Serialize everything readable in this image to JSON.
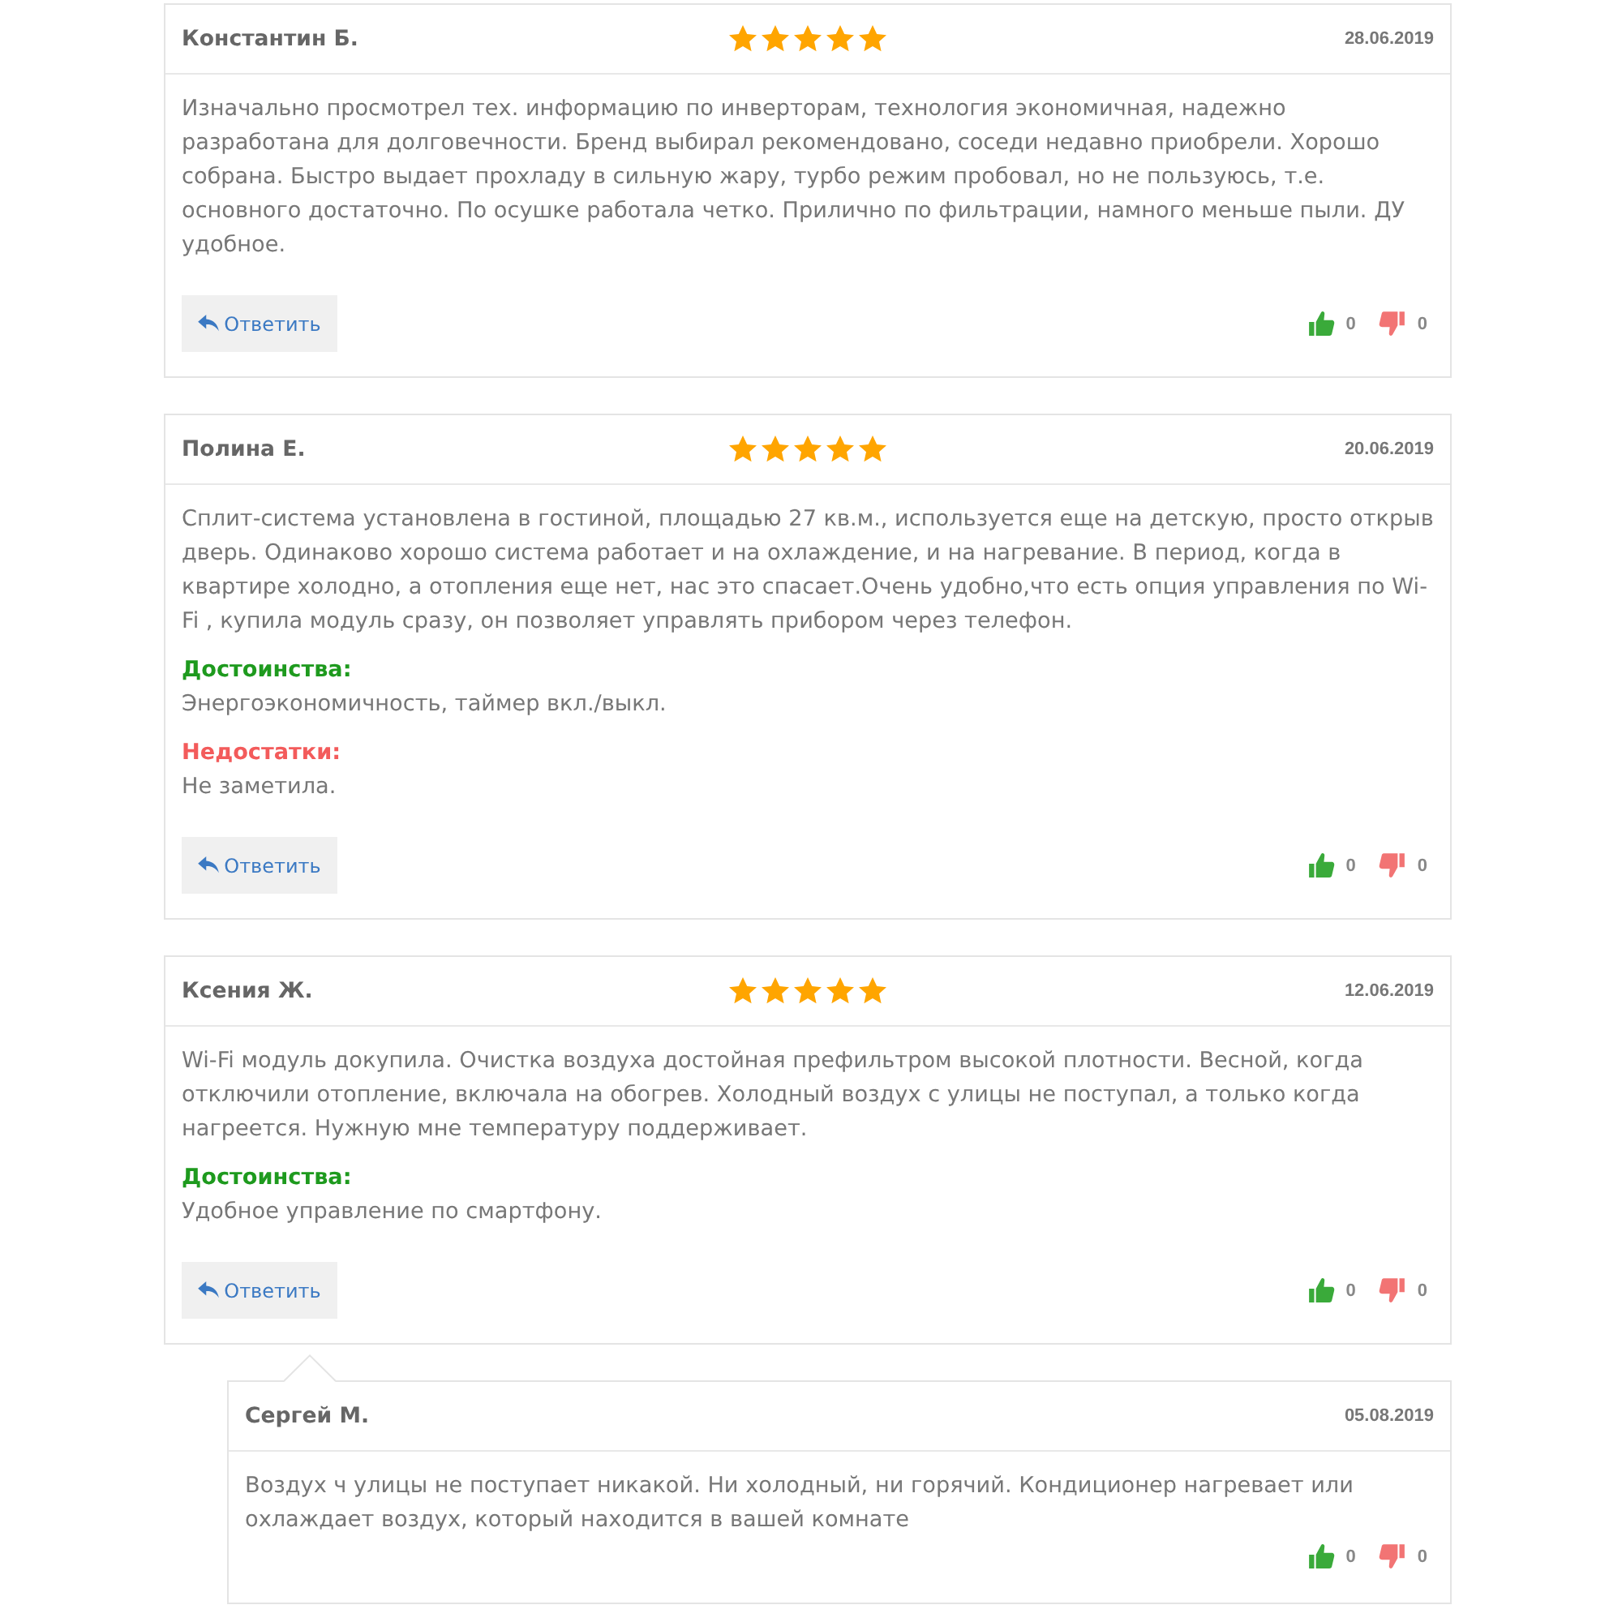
{
  "reviews": [
    {
      "author": "Константин Б.",
      "stars": 5,
      "date": "28.06.2019",
      "text": "Изначально просмотрел тех. информацию по инверторам, технология экономичная, надежно разработана для долговечности. Бренд выбирал рекомендовано, соседи недавно приобрели. Хорошо собрана. Быстро выдает прохладу в сильную жару, турбо режим пробовал, но не пользуюсь, т.е. основного достаточно. По осушке работала четко. Прилично по фильтрации, намного меньше пыли. ДУ удобное.",
      "reply_button": "Ответить",
      "likes": "0",
      "dislikes": "0"
    },
    {
      "author": "Полина Е.",
      "stars": 5,
      "date": "20.06.2019",
      "text": "Сплит-система установлена в гостиной, площадью 27 кв.м., используется еще на детскую, просто открыв дверь. Одинаково хорошо система работает и на охлаждение, и на нагревание. В период, когда в квартире холодно, а отопления еще нет, нас это спасает.Очень удобно,что есть опция управления по Wi-Fi , купила модуль сразу, он позволяет управлять прибором через телефон.",
      "sections": [
        {
          "kind": "pros",
          "label": "Достоинства:",
          "text": "Энергоэкономичность, таймер вкл./выкл."
        },
        {
          "kind": "cons",
          "label": "Недостатки:",
          "text": "Не заметила."
        }
      ],
      "reply_button": "Ответить",
      "likes": "0",
      "dislikes": "0"
    },
    {
      "author": "Ксения Ж.",
      "stars": 5,
      "date": "12.06.2019",
      "text": "Wi-Fi модуль докупила. Очистка воздуха достойная префильтром высокой плотности. Весной, когда отключили отопление, включала на обогрев. Холодный воздух с улицы не поступал, а только когда нагреется. Нужную мне температуру поддерживает.",
      "sections": [
        {
          "kind": "pros",
          "label": "Достоинства:",
          "text": "Удобное управление по смартфону."
        }
      ],
      "reply_button": "Ответить",
      "likes": "0",
      "dislikes": "0",
      "replies": [
        {
          "author": "Сергей М.",
          "date": "05.08.2019",
          "text": "Воздух ч улицы не поступает никакой. Ни холодный, ни горячий. Кондиционер нагревает или охлаждает воздух, который находится в вашей комнате",
          "likes": "0",
          "dislikes": "0"
        }
      ]
    }
  ]
}
